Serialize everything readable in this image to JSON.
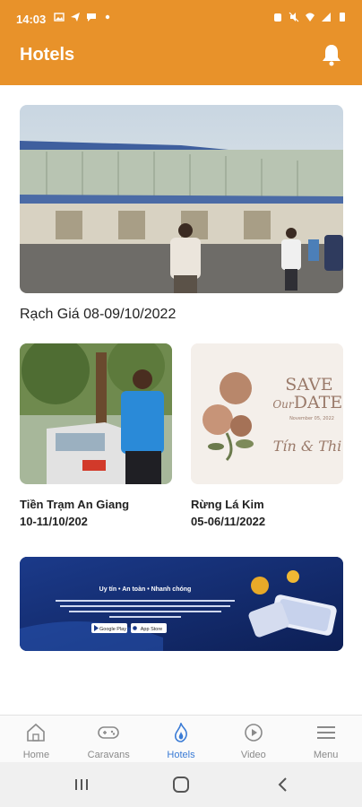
{
  "status_bar": {
    "time": "14:03"
  },
  "app_bar": {
    "title": "Hotels"
  },
  "feed": {
    "hero": {
      "caption": "Rạch Giá 08-09/10/2022"
    },
    "cards": [
      {
        "title_line1": "Tiền Trạm An Giang",
        "title_line2": "10-11/10/202"
      },
      {
        "title_line1": "Rừng Lá Kim",
        "title_line2": "05-06/11/2022"
      }
    ],
    "save_the_date": {
      "save": "SAVE",
      "our": "Our",
      "date": "DATE",
      "small_date": "November 05, 2022",
      "names": "Tín & Thi"
    },
    "banner": {
      "tagline": "Uy tín • An toàn • Nhanh chóng",
      "google_play": "Google Play",
      "app_store": "App Store"
    }
  },
  "bottom_nav": {
    "items": [
      {
        "label": "Home",
        "icon": "home-icon"
      },
      {
        "label": "Caravans",
        "icon": "gamepad-icon"
      },
      {
        "label": "Hotels",
        "icon": "flame-icon"
      },
      {
        "label": "Video",
        "icon": "play-circle-icon"
      },
      {
        "label": "Menu",
        "icon": "hamburger-icon"
      }
    ],
    "active": "Hotels"
  },
  "colors": {
    "accent": "#e8922a",
    "active_nav": "#3a7bd5",
    "banner_bg": "#142a6a"
  }
}
